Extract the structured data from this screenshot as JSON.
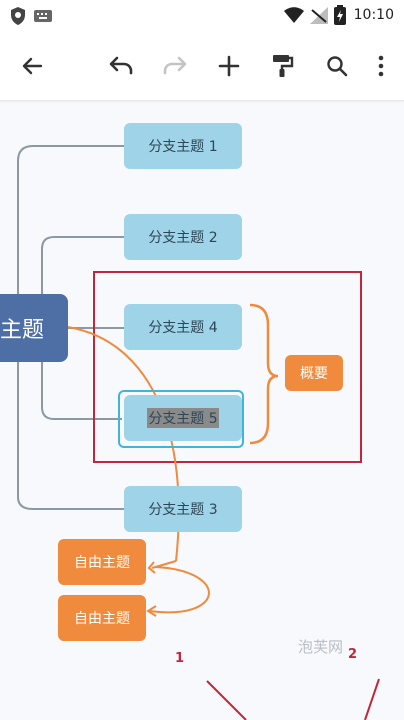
{
  "status_bar": {
    "time": "10:10"
  },
  "toolbar": {
    "icons": [
      "back-arrow-icon",
      "undo-icon",
      "redo-icon",
      "add-icon",
      "format-paint-icon",
      "search-icon",
      "more-vert-icon"
    ]
  },
  "mindmap": {
    "central_topic": "主题",
    "branches": [
      "分支主题 1",
      "分支主题 2",
      "分支主题 4",
      "分支主题 5",
      "分支主题 3"
    ],
    "summary": "概要",
    "free_topics": [
      "自由主题",
      "自由主题"
    ]
  },
  "watermark": "泡芙网",
  "annotations": [
    "1",
    "2"
  ],
  "colors": {
    "branch_bg": "#9fd3e8",
    "central_bg": "#4e6fa5",
    "accent_orange": "#f08a3c",
    "selection_blue": "#3fb6d9",
    "boundary_red": "#c0283a"
  }
}
